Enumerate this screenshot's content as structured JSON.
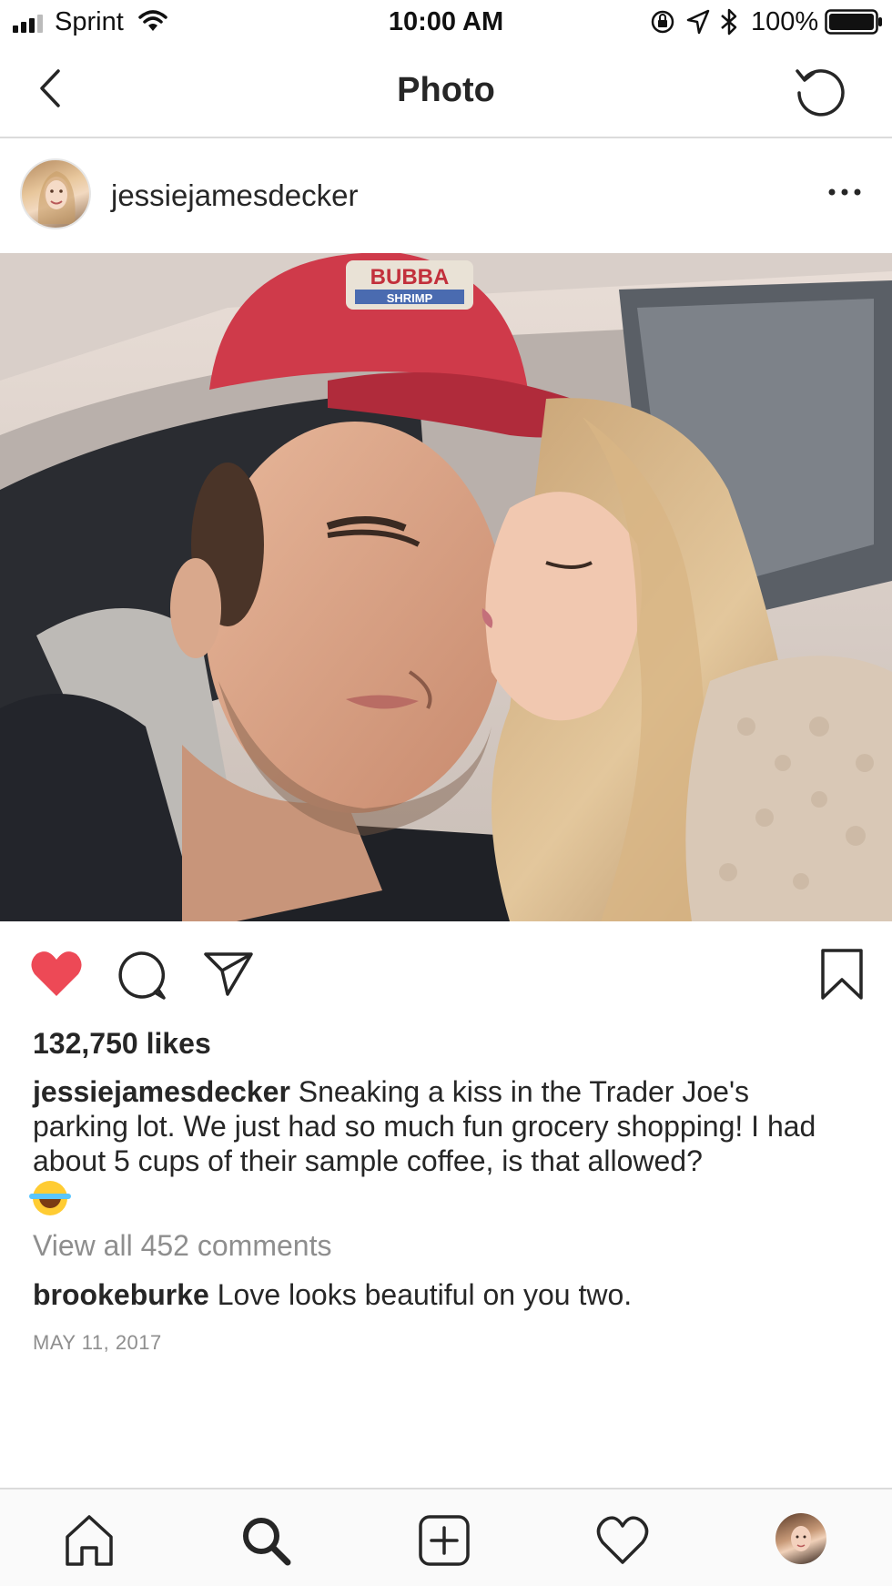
{
  "status_bar": {
    "carrier": "Sprint",
    "time": "10:00 AM",
    "battery_percent": "100%",
    "icons": [
      "signal-icon",
      "wifi-icon",
      "rotation-lock-icon",
      "location-icon",
      "bluetooth-icon",
      "battery-icon"
    ]
  },
  "nav": {
    "title": "Photo",
    "back_icon": "chevron-left-icon",
    "refresh_icon": "refresh-icon"
  },
  "post": {
    "username": "jessiejamesdecker",
    "likes": "132,750 likes",
    "caption_user": "jessiejamesdecker",
    "caption_text": "Sneaking a kiss in the Trader Joe's parking lot. We just had so much fun grocery shopping! I had about 5 cups of their sample coffee, is that allowed?",
    "caption_emoji": "😂",
    "view_comments": "View all 452 comments",
    "comment_user": "brookeburke",
    "comment_text": "Love looks beautiful on you two.",
    "date": "MAY 11, 2017",
    "liked": true
  },
  "photo_text": {
    "hat_line1": "BUBBA",
    "hat_line2": "SHRIMP"
  },
  "colors": {
    "like_red": "#ed4956",
    "text": "#262626",
    "muted": "#8e8e8e",
    "divider": "#dbdbdb"
  },
  "tab_bar": {
    "items": [
      "home-icon",
      "search-icon",
      "add-icon",
      "heart-icon",
      "profile-avatar"
    ]
  }
}
